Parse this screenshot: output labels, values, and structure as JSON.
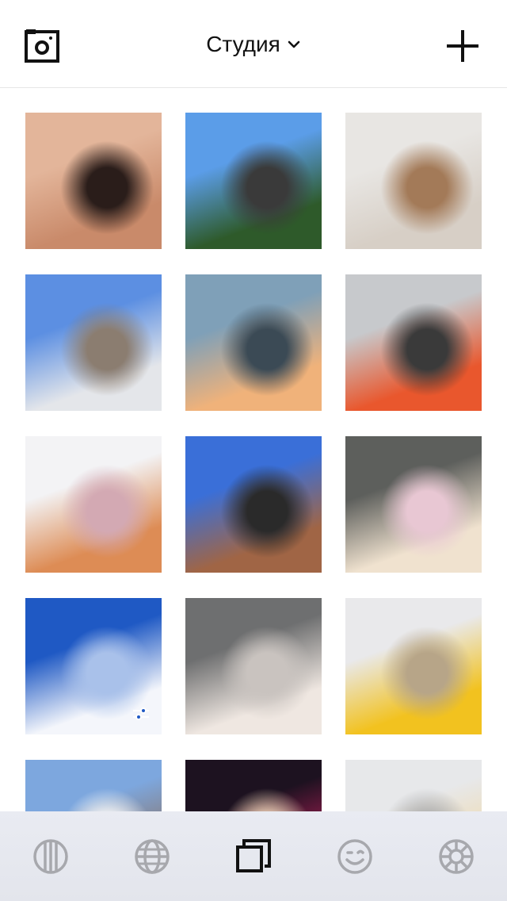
{
  "header": {
    "title": "Студия",
    "camera_icon": "camera-square-icon",
    "chevron_icon": "chevron-down-icon",
    "add_icon": "plus-icon"
  },
  "grid": {
    "tiles": [
      {
        "name": "photo-neck-skin",
        "colors": [
          "#e3b59a",
          "#c98a6a",
          "#2a1d1a"
        ]
      },
      {
        "name": "photo-girl-road-legs-up",
        "colors": [
          "#5b9de8",
          "#2e5a2a",
          "#3a3a3a"
        ]
      },
      {
        "name": "photo-pampas-grass",
        "colors": [
          "#e8e6e3",
          "#d7cfc6",
          "#a37a58"
        ]
      },
      {
        "name": "photo-girl-denim-jacket",
        "colors": [
          "#5c8fe2",
          "#e4e6ea",
          "#8b7d70"
        ]
      },
      {
        "name": "photo-cloudy-sunset",
        "colors": [
          "#7fa0b8",
          "#f0b27a",
          "#3b4a55"
        ]
      },
      {
        "name": "photo-girl-stadium-seats",
        "colors": [
          "#c7c9cc",
          "#e9572d",
          "#3a3a3a"
        ]
      },
      {
        "name": "photo-ginger-cat",
        "colors": [
          "#f3f3f5",
          "#dd8c55",
          "#d3a9b3"
        ]
      },
      {
        "name": "photo-girl-blue-sky-house",
        "colors": [
          "#3a6fd8",
          "#a06545",
          "#2a2a2a"
        ]
      },
      {
        "name": "photo-blonde-tongue-out",
        "colors": [
          "#5d5f5c",
          "#f0e2cf",
          "#e8c7d3"
        ]
      },
      {
        "name": "photo-clouds-blue-sky",
        "colors": [
          "#1f59c4",
          "#f4f6fb",
          "#a9c1ea"
        ]
      },
      {
        "name": "photo-hand-neck-grey",
        "colors": [
          "#6e6f70",
          "#efe7e1",
          "#c9c3bf"
        ]
      },
      {
        "name": "photo-bananas-plate",
        "colors": [
          "#e9e9eb",
          "#f2c21f",
          "#b7a588"
        ]
      },
      {
        "name": "photo-girl-trees-sky",
        "colors": [
          "#7da7de",
          "#8b6f5e",
          "#f2f2f2"
        ]
      },
      {
        "name": "photo-girl-christmas-tree",
        "colors": [
          "#1d1220",
          "#b81f5a",
          "#e7cbb2"
        ]
      },
      {
        "name": "photo-girl-white-wall",
        "colors": [
          "#e7e8ea",
          "#f0d9a8",
          "#b0b0b0"
        ]
      }
    ],
    "edit_badge_icon": "sliders-icon"
  },
  "tabbar": {
    "tabs": [
      {
        "icon": "columns-icon",
        "active": false
      },
      {
        "icon": "globe-icon",
        "active": false
      },
      {
        "icon": "studio-stack-icon",
        "active": true
      },
      {
        "icon": "smiley-wink-icon",
        "active": false
      },
      {
        "icon": "aperture-icon",
        "active": false
      }
    ]
  }
}
